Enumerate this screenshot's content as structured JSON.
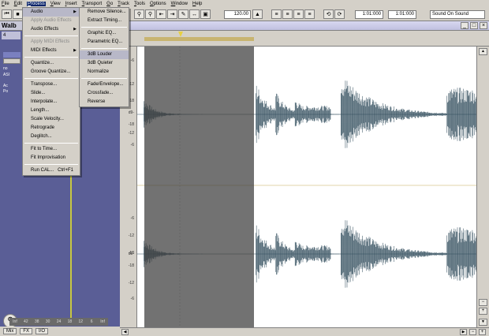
{
  "menubar": [
    "File",
    "Edit",
    "Process",
    "View",
    "Insert",
    "Transport",
    "Go",
    "Track",
    "Tools",
    "Options",
    "Window",
    "Help"
  ],
  "toolbar": {
    "tempo": "120.00",
    "time_start": "1:01:000",
    "time_end": "1:01:000",
    "sound_on_sound": "Sound On Sound"
  },
  "track_window": {
    "title": "Walb",
    "rows": [
      "4",
      "Ac",
      "Po",
      "no",
      "ASI",
      "Ac",
      "Po"
    ],
    "meter": [
      "Inf",
      "42",
      "38",
      "30",
      "24",
      "18",
      "12",
      "6",
      "Inf"
    ],
    "tabs": [
      "Mix",
      "FX",
      "I/O"
    ]
  },
  "db_labels": [
    "-6",
    "-12",
    "-18",
    "d9-",
    "-18",
    "-12",
    "-6",
    "-6",
    "-12",
    "-18",
    "d9-",
    "-18",
    "-12",
    "-6"
  ],
  "process_menu": {
    "items": [
      {
        "label": "Audio",
        "submenu": true,
        "disabled": false,
        "highlight": "active"
      },
      {
        "label": "Apply Audio Effects",
        "submenu": false,
        "disabled": true
      },
      {
        "label": "Audio Effects",
        "submenu": true,
        "disabled": false
      },
      {
        "sep": true
      },
      {
        "label": "Apply MIDI Effects",
        "submenu": false,
        "disabled": true
      },
      {
        "label": "MIDI Effects",
        "submenu": true,
        "disabled": false
      },
      {
        "sep": true
      },
      {
        "label": "Quantize...",
        "submenu": false,
        "disabled": false
      },
      {
        "label": "Groove Quantize...",
        "submenu": false,
        "disabled": false
      },
      {
        "sep": true
      },
      {
        "label": "Transpose...",
        "submenu": false,
        "disabled": false
      },
      {
        "label": "Slide...",
        "submenu": false,
        "disabled": false
      },
      {
        "label": "Interpolate...",
        "submenu": false,
        "disabled": false
      },
      {
        "label": "Length...",
        "submenu": false,
        "disabled": false
      },
      {
        "label": "Scale Velocity...",
        "submenu": false,
        "disabled": false
      },
      {
        "label": "Retrograde",
        "submenu": false,
        "disabled": false
      },
      {
        "label": "Deglitch...",
        "submenu": false,
        "disabled": false
      },
      {
        "sep": true
      },
      {
        "label": "Fit to Time...",
        "submenu": false,
        "disabled": false
      },
      {
        "label": "Fit Improvisation",
        "submenu": false,
        "disabled": false
      },
      {
        "sep": true
      },
      {
        "label": "Run CAL...",
        "shortcut": "Ctrl+F1",
        "submenu": false,
        "disabled": false
      }
    ]
  },
  "audio_submenu": {
    "items": [
      {
        "label": "Remove Silence..."
      },
      {
        "label": "Extract Timing..."
      },
      {
        "sep": true
      },
      {
        "label": "Graphic EQ..."
      },
      {
        "label": "Parametric EQ..."
      },
      {
        "sep": true
      },
      {
        "label": "3dB Louder",
        "highlight": true
      },
      {
        "label": "3dB Quieter"
      },
      {
        "label": "Normalize"
      },
      {
        "sep": true
      },
      {
        "label": "Fade/Envelope..."
      },
      {
        "label": "Crossfade..."
      },
      {
        "label": "Reverse"
      }
    ]
  },
  "colors": {
    "waveform": "#2e4a5a",
    "selection": "#4a4a4a",
    "track_panel": "#5a5e96",
    "highlight": "#0a246a"
  }
}
